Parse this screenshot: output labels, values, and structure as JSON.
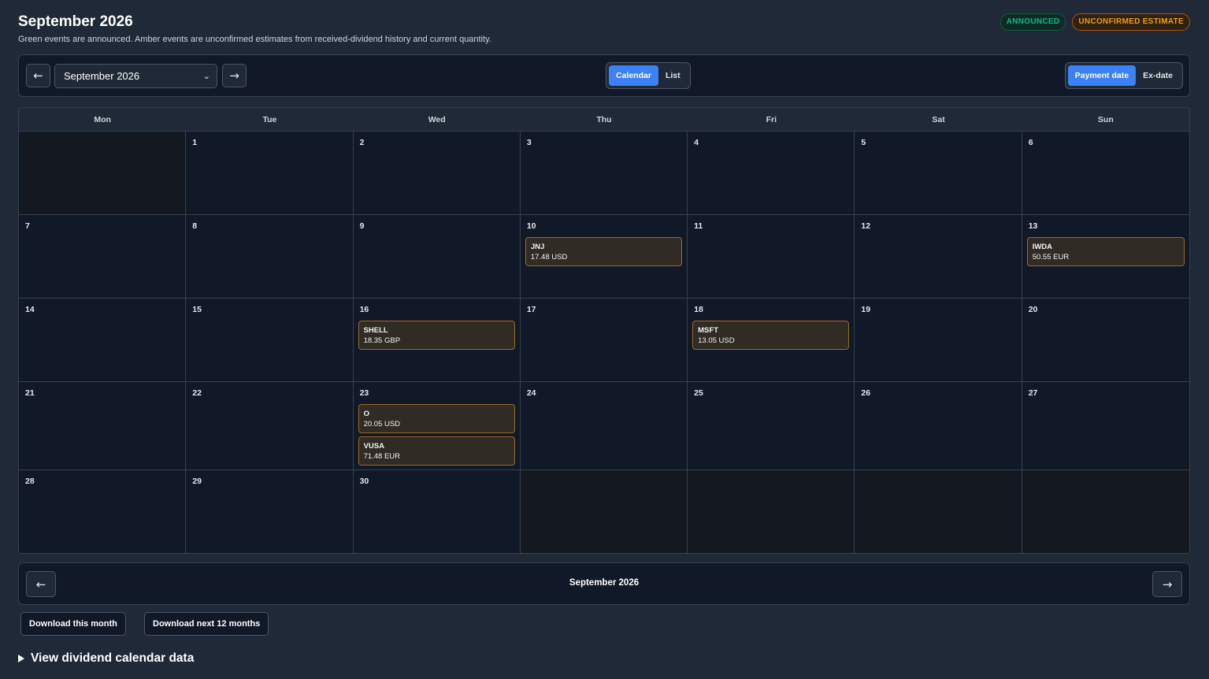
{
  "header": {
    "title": "September 2026",
    "subtitle": "Green events are announced. Amber events are unconfirmed estimates from received-dividend history and current quantity.",
    "legend_announced": "ANNOUNCED",
    "legend_estimate": "UNCONFIRMED ESTIMATE"
  },
  "toolbar": {
    "prev_label": "←",
    "next_label": "→",
    "month_select_value": "September 2026",
    "view_toggle": [
      "Calendar",
      "List"
    ],
    "view_active": "Calendar",
    "date_toggle": [
      "Payment date",
      "Ex-date"
    ],
    "date_active": "Payment date"
  },
  "calendar": {
    "weekdays": [
      "Mon",
      "Tue",
      "Wed",
      "Thu",
      "Fri",
      "Sat",
      "Sun"
    ],
    "weeks": [
      [
        null,
        "1",
        "2",
        "3",
        "4",
        "5",
        "6"
      ],
      [
        "7",
        "8",
        "9",
        "10",
        "11",
        "12",
        "13"
      ],
      [
        "14",
        "15",
        "16",
        "17",
        "18",
        "19",
        "20"
      ],
      [
        "21",
        "22",
        "23",
        "24",
        "25",
        "26",
        "27"
      ],
      [
        "28",
        "29",
        "30",
        null,
        null,
        null,
        null
      ]
    ],
    "events": {
      "10": [
        {
          "ticker": "JNJ",
          "amount": "17.48 USD",
          "status": "estimate"
        }
      ],
      "13": [
        {
          "ticker": "IWDA",
          "amount": "50.55 EUR",
          "status": "estimate"
        }
      ],
      "16": [
        {
          "ticker": "SHELL",
          "amount": "18.35 GBP",
          "status": "estimate"
        }
      ],
      "18": [
        {
          "ticker": "MSFT",
          "amount": "13.05 USD",
          "status": "estimate"
        }
      ],
      "23": [
        {
          "ticker": "O",
          "amount": "20.05 USD",
          "status": "estimate"
        },
        {
          "ticker": "VUSA",
          "amount": "71.48 EUR",
          "status": "estimate"
        }
      ]
    }
  },
  "footer_nav": {
    "prev_label": "←",
    "next_label": "→",
    "month_label": "September 2026"
  },
  "downloads": {
    "this_month": "Download this month",
    "next_12": "Download next 12 months"
  },
  "details": {
    "label": "View dividend calendar data"
  },
  "colors": {
    "background": "#1f2937",
    "panel": "#111827",
    "accent": "#3b82f6",
    "announced": "#10b981",
    "estimate": "#f59e0b"
  }
}
